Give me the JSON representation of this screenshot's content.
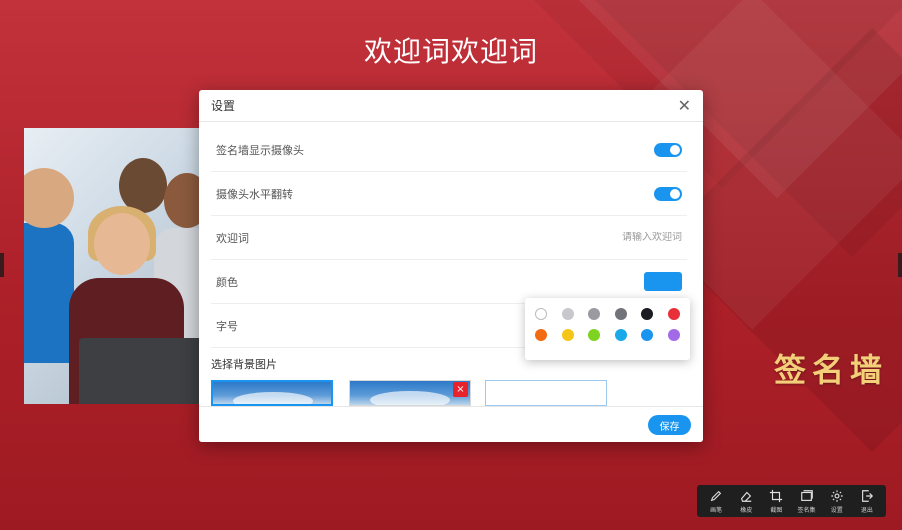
{
  "welcome_text": "欢迎词欢迎词",
  "brand_text": "签名墙",
  "modal": {
    "title": "设置",
    "rows": {
      "camera_show": {
        "label": "签名墙显示摄像头",
        "enabled": true
      },
      "camera_flip": {
        "label": "摄像头水平翻转",
        "enabled": true
      },
      "welcome": {
        "label": "欢迎词",
        "placeholder": "请输入欢迎词"
      },
      "color": {
        "label": "颜色",
        "value": "#1a95ef"
      },
      "font_size": {
        "label": "字号"
      }
    },
    "bg_section_label": "选择背景图片",
    "delete_symbol": "×",
    "save_label": "保存"
  },
  "palette": {
    "row1": [
      "#ffffff",
      "#c8c8cc",
      "#9a9aa0",
      "#72727a",
      "#1b1b22",
      "#e8303a"
    ],
    "row2": [
      "#f26b12",
      "#f5c518",
      "#7ed321",
      "#1aa8e8",
      "#1a95ef",
      "#a36ae8"
    ]
  },
  "toolbar": {
    "pen": "画笔",
    "eraser": "橡皮",
    "crop": "截图",
    "gallery": "签名集",
    "settings": "设置",
    "exit": "退出"
  }
}
